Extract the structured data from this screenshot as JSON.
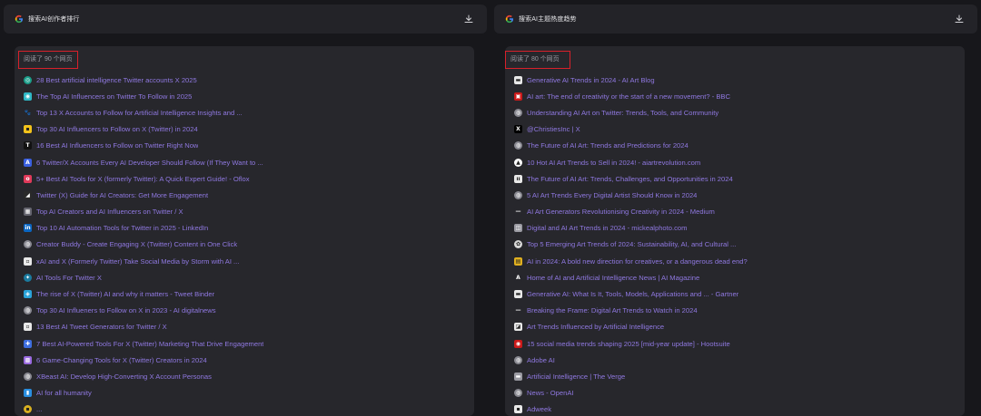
{
  "left": {
    "title": "搜索AI创作者排行",
    "count_label": "阅读了 90 个网页",
    "items": [
      {
        "title": "28 Best artificial intelligence Twitter accounts X 2025",
        "icon": "globe-icon",
        "color": "#1b9e8a",
        "glyph": "◎",
        "round": true
      },
      {
        "title": "The Top AI Influencers on Twitter To Follow in 2025",
        "icon": "site-favicon-icon",
        "color": "#2fb8c6",
        "glyph": "◉",
        "round": false
      },
      {
        "title": "Top 13 X Accounts to Follow for Artificial Intelligence Insights and ...",
        "icon": "paw-icon",
        "color": "#27272c",
        "glyph": "🐾",
        "round": false
      },
      {
        "title": "Top 30 AI Influencers to Follow on X (Twitter) in 2024",
        "icon": "site-favicon-icon",
        "color": "#f2c21b",
        "glyph": "▪",
        "round": false
      },
      {
        "title": "16 Best AI Influencers to Follow on Twitter Right Now",
        "icon": "letter-t-icon",
        "color": "#111111",
        "glyph": "T",
        "round": false
      },
      {
        "title": "6 Twitter/X Accounts Every AI Developer Should Follow (If They Want to ...",
        "icon": "site-favicon-icon",
        "color": "#3a5fe0",
        "glyph": "A",
        "round": false
      },
      {
        "title": "5+ Best AI Tools for X (formerly Twitter): A Quick Expert Guide! - Oflox",
        "icon": "site-favicon-icon",
        "color": "#e03a5a",
        "glyph": "o",
        "round": false
      },
      {
        "title": "Twitter (X) Guide for AI Creators: Get More Engagement",
        "icon": "site-favicon-icon",
        "color": "#2a2a2a",
        "glyph": "◢",
        "round": false
      },
      {
        "title": "Top AI Creators and AI Influencers on Twitter / X",
        "icon": "site-favicon-icon",
        "color": "#666670",
        "glyph": "▦",
        "round": false
      },
      {
        "title": "Top 10 AI Automation Tools for Twitter in 2025 - LinkedIn",
        "icon": "linkedin-icon",
        "color": "#0a66c2",
        "glyph": "in",
        "round": false
      },
      {
        "title": "Creator Buddy - Create Engaging X (Twitter) Content in One Click",
        "icon": "globe-icon",
        "color": "#8a8a92",
        "glyph": "◍",
        "round": true
      },
      {
        "title": "xAI and X (Formerly Twitter) Take Social Media by Storm with AI ...",
        "icon": "site-favicon-icon",
        "color": "#e8e8e8",
        "glyph": "▫",
        "round": false
      },
      {
        "title": "AI Tools For Twitter X",
        "icon": "site-favicon-icon",
        "color": "#1b7a9e",
        "glyph": "✦",
        "round": true
      },
      {
        "title": "The rise of X (Twitter) AI and why it matters - Tweet Binder",
        "icon": "site-favicon-icon",
        "color": "#2aa3d8",
        "glyph": "◈",
        "round": false
      },
      {
        "title": "Top 30 AI Influeners to Follow on X in 2023 - AI digitalnews",
        "icon": "globe-icon",
        "color": "#8a8a92",
        "glyph": "◍",
        "round": true
      },
      {
        "title": "13 Best AI Tweet Generators for Twitter / X",
        "icon": "site-favicon-icon",
        "color": "#e8e8e8",
        "glyph": "▫",
        "round": false
      },
      {
        "title": "7 Best AI-Powered Tools For X (Twitter) Marketing That Drive Engagement",
        "icon": "site-favicon-icon",
        "color": "#3e6ee0",
        "glyph": "✚",
        "round": false
      },
      {
        "title": "6 Game-Changing Tools for X (Twitter) Creators in 2024",
        "icon": "site-favicon-icon",
        "color": "#9a6ae0",
        "glyph": "▩",
        "round": false
      },
      {
        "title": "XBeast AI: Develop High-Converting X Account Personas",
        "icon": "globe-icon",
        "color": "#8a8a92",
        "glyph": "◍",
        "round": true
      },
      {
        "title": "AI for all humanity",
        "icon": "site-favicon-icon",
        "color": "#2a8ee0",
        "glyph": "▮",
        "round": false
      },
      {
        "title": "...",
        "icon": "site-favicon-icon",
        "color": "#d8b020",
        "glyph": "▪",
        "round": true
      }
    ]
  },
  "right": {
    "title": "搜索AI主题热度趋势",
    "count_label": "阅读了 80 个网页",
    "items": [
      {
        "title": "Generative AI Trends in 2024 - AI Art Blog",
        "icon": "site-favicon-icon",
        "color": "#e8e8e8",
        "glyph": "▬",
        "round": false
      },
      {
        "title": "AI art: The end of creativity or the start of a new movement? - BBC",
        "icon": "bbc-icon",
        "color": "#cc1a1a",
        "glyph": "▣",
        "round": false
      },
      {
        "title": "Understanding AI Art on Twitter: Trends, Tools, and Community",
        "icon": "globe-icon",
        "color": "#8a8a92",
        "glyph": "◍",
        "round": true
      },
      {
        "title": "@ChristiesInc | X",
        "icon": "x-icon",
        "color": "#000000",
        "glyph": "X",
        "round": false
      },
      {
        "title": "The Future of AI Art: Trends and Predictions for 2024",
        "icon": "globe-icon",
        "color": "#8a8a92",
        "glyph": "◍",
        "round": true
      },
      {
        "title": "10 Hot AI Art Trends to Sell in 2024! - aiartrevolution.com",
        "icon": "site-favicon-icon",
        "color": "#ffffff",
        "glyph": "▲",
        "round": true
      },
      {
        "title": "The Future of AI Art: Trends, Challenges, and Opportunities in 2024",
        "icon": "site-favicon-icon",
        "color": "#e8e8e8",
        "glyph": "ıı",
        "round": false
      },
      {
        "title": "5 AI Art Trends Every Digital Artist Should Know in 2024",
        "icon": "globe-icon",
        "color": "#8a8a92",
        "glyph": "◍",
        "round": true
      },
      {
        "title": "AI Art Generators Revolutionising Creativity in 2024 - Medium",
        "icon": "medium-icon",
        "color": "#27272c",
        "glyph": "—",
        "round": false
      },
      {
        "title": "Digital and AI Art Trends in 2024 - mickealphoto.com",
        "icon": "site-favicon-icon",
        "color": "#9a9aa2",
        "glyph": "◫",
        "round": false
      },
      {
        "title": "Top 5 Emerging Art Trends of 2024: Sustainability, AI, and Cultural ...",
        "icon": "site-favicon-icon",
        "color": "#d8d8d8",
        "glyph": "✿",
        "round": true
      },
      {
        "title": "AI in 2024: A bold new direction for creatives, or a dangerous dead end?",
        "icon": "site-favicon-icon",
        "color": "#e0b020",
        "glyph": "▤",
        "round": false
      },
      {
        "title": "Home of AI and Artificial Intelligence News | AI Magazine",
        "icon": "site-favicon-icon",
        "color": "#27272c",
        "glyph": "A",
        "round": false
      },
      {
        "title": "Generative AI: What Is It, Tools, Models, Applications and ... - Gartner",
        "icon": "site-favicon-icon",
        "color": "#e8e8e8",
        "glyph": "▬",
        "round": false
      },
      {
        "title": "Breaking the Frame: Digital Art Trends to Watch in 2024",
        "icon": "site-favicon-icon",
        "color": "#27272c",
        "glyph": "—",
        "round": false
      },
      {
        "title": "Art Trends Influenced by Artificial Intelligence",
        "icon": "site-favicon-icon",
        "color": "#e8e8e8",
        "glyph": "◪",
        "round": false
      },
      {
        "title": "15 social media trends shaping 2025 [mid-year update] - Hootsuite",
        "icon": "hootsuite-icon",
        "color": "#cc1a1a",
        "glyph": "◉",
        "round": false
      },
      {
        "title": "Adobe AI",
        "icon": "globe-icon",
        "color": "#8a8a92",
        "glyph": "◍",
        "round": true
      },
      {
        "title": "Artificial Intelligence | The Verge",
        "icon": "verge-icon",
        "color": "#9a9aa2",
        "glyph": "▬",
        "round": false
      },
      {
        "title": "News - OpenAI",
        "icon": "globe-icon",
        "color": "#8a8a92",
        "glyph": "◍",
        "round": true
      },
      {
        "title": "Adweek",
        "icon": "site-favicon-icon",
        "color": "#e8e8e8",
        "glyph": "▪",
        "round": false
      }
    ]
  }
}
